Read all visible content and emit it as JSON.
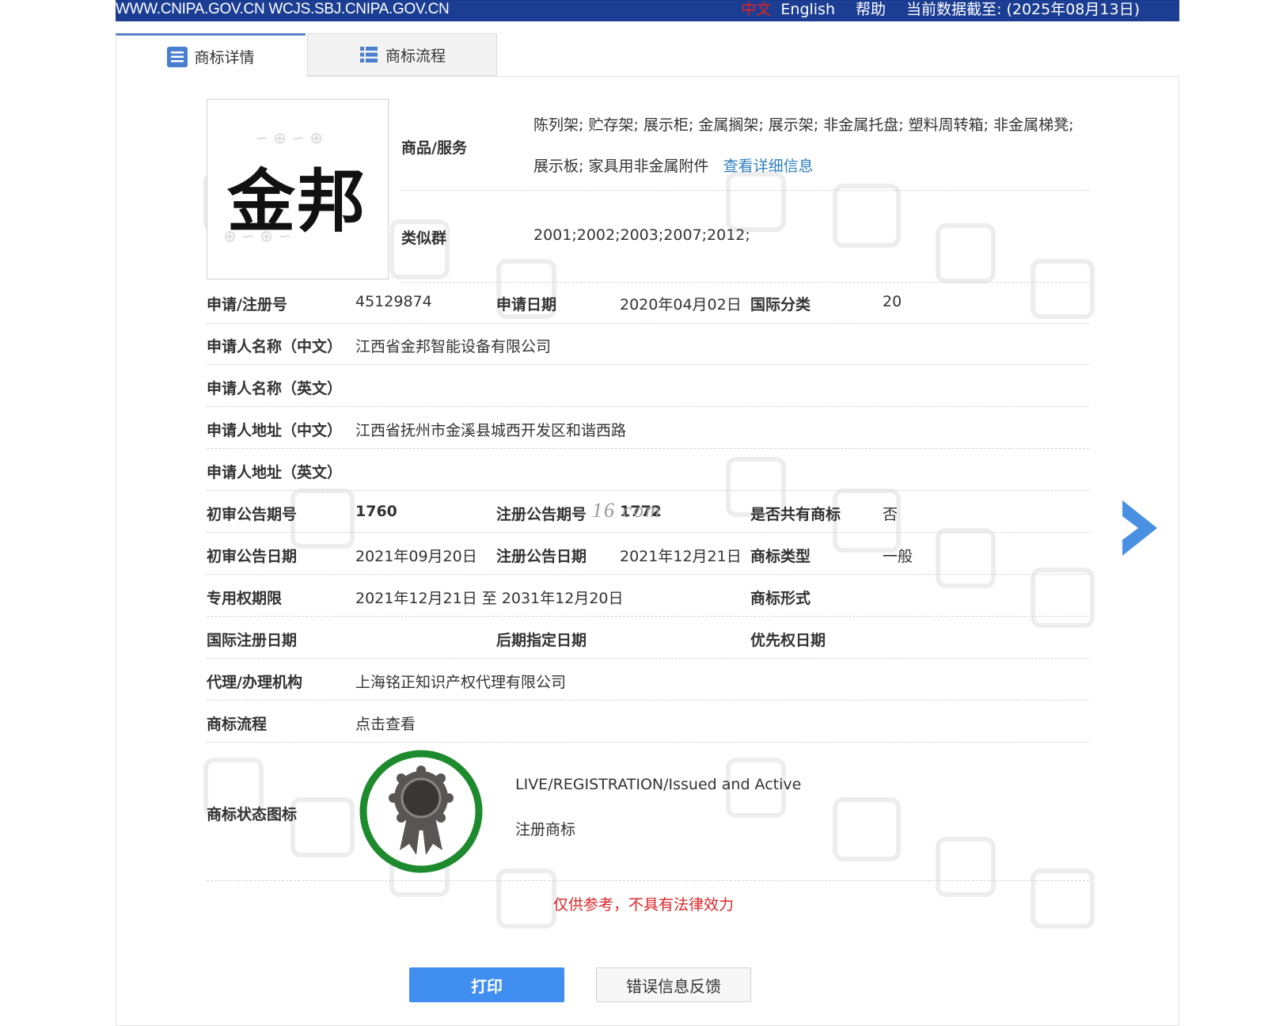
{
  "topbar": {
    "site": "WWW.CNIPA.GOV.CN WCJS.SBJ.CNIPA.GOV.CN",
    "lang_cn": "中文",
    "lang_en": "English",
    "help": "帮助",
    "data_date": "当前数据截至: (2025年08月13日)"
  },
  "tabs": {
    "detail": "商标详情",
    "process": "商标流程"
  },
  "trademark": {
    "mark_text": "金邦",
    "goods_label": "商品/服务",
    "goods_text": "陈列架; 贮存架; 展示柜; 金属搁架; 展示架; 非金属托盘; 塑料周转箱; 非金属梯凳; 展示板; 家具用非金属附件",
    "goods_link": "查看详细信息",
    "similar_label": "类似群",
    "similar_value": "2001;2002;2003;2007;2012;"
  },
  "fields": {
    "reg_no_label": "申请/注册号",
    "reg_no": "45129874",
    "app_date_label": "申请日期",
    "app_date": "2020年04月02日",
    "intl_class_label": "国际分类",
    "intl_class": "20",
    "applicant_cn_label": "申请人名称（中文）",
    "applicant_cn": "江西省金邦智能设备有限公司",
    "applicant_en_label": "申请人名称（英文）",
    "applicant_en": "",
    "address_cn_label": "申请人地址（中文）",
    "address_cn": "江西省抚州市金溪县城西开发区和谐西路",
    "address_en_label": "申请人地址（英文）",
    "address_en": "",
    "prelim_no_label": "初审公告期号",
    "prelim_no": "1760",
    "reg_pub_no_label": "注册公告期号",
    "reg_pub_no": "1772",
    "shared_label": "是否共有商标",
    "shared": "否",
    "prelim_date_label": "初审公告日期",
    "prelim_date": "2021年09月20日",
    "reg_pub_date_label": "注册公告日期",
    "reg_pub_date": "2021年12月21日",
    "tm_type_label": "商标类型",
    "tm_type": "一般",
    "term_label": "专用权期限",
    "term": "2021年12月21日 至 2031年12月20日",
    "tm_form_label": "商标形式",
    "tm_form": "",
    "intl_reg_date_label": "国际注册日期",
    "later_date_label": "后期指定日期",
    "priority_date_label": "优先权日期",
    "agent_label": "代理/办理机构",
    "agent": "上海铭正知识产权代理有限公司",
    "process_label": "商标流程",
    "process_link": "点击查看",
    "status_label": "商标状态图标",
    "status_en": "LIVE/REGISTRATION/Issued and Active",
    "status_cn": "注册商标"
  },
  "overlay_watermark": "16 com",
  "disclaimer": "仅供参考，不具有法律效力",
  "buttons": {
    "print": "打印",
    "feedback": "错误信息反馈"
  },
  "colors": {
    "topbar": "#1f45a2",
    "link": "#2f7fbf",
    "print_button": "#3f8ef0",
    "disclaimer": "#d9262a",
    "status_ring": "#1e8a2e",
    "arrow": "#4a90e2"
  },
  "icons": {
    "detail_tab": "list-icon",
    "process_tab": "grid-list-icon",
    "status": "award-ribbon-icon",
    "next": "chevron-right-icon"
  }
}
